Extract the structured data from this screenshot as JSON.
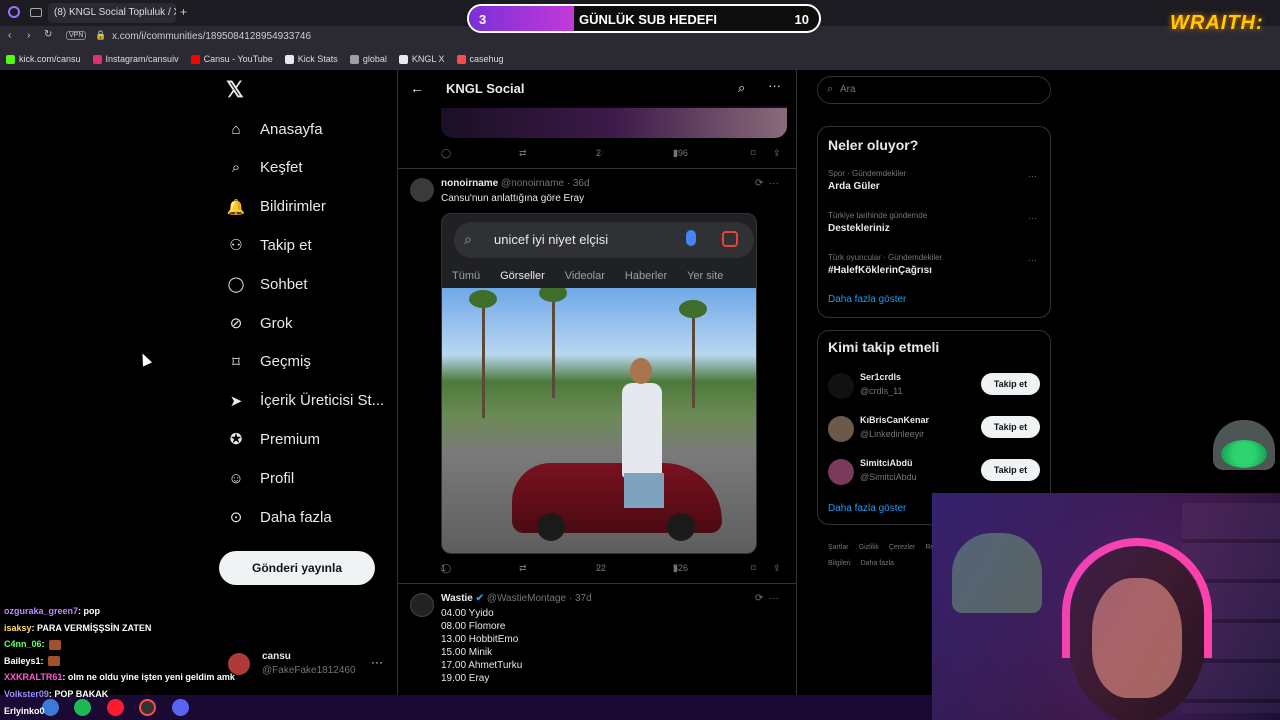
{
  "browser": {
    "tab_title": "(8) KNGL Social Topluluk / X",
    "url": "x.com/i/communities/1895084128954933746",
    "vpn": "VPN",
    "bookmarks": [
      {
        "label": "kick.com/cansu",
        "color": "#53fc18"
      },
      {
        "label": "Instagram/cansuiv",
        "color": "#e1306c"
      },
      {
        "label": "Cansu - YouTube",
        "color": "#ff0000"
      },
      {
        "label": "Kick Stats",
        "color": "#e7e9ea"
      },
      {
        "label": "global",
        "color": "#9aa0a6"
      },
      {
        "label": "KNGL X",
        "color": "#e7e9ea"
      },
      {
        "label": "casehug",
        "color": "#ff4a4a"
      }
    ]
  },
  "overlay": {
    "sub_goal": {
      "current": "3",
      "label": "GÜNLÜK SUB HEDEFI",
      "target": "10",
      "progress": 0.3
    },
    "brand": "WRAITH:"
  },
  "nav": {
    "items": [
      {
        "label": "Anasayfa",
        "icon": "home-icon"
      },
      {
        "label": "Keşfet",
        "icon": "search-icon"
      },
      {
        "label": "Bildirimler",
        "icon": "bell-icon"
      },
      {
        "label": "Takip et",
        "icon": "add-person-icon"
      },
      {
        "label": "Sohbet",
        "icon": "chat-icon"
      },
      {
        "label": "Grok",
        "icon": "grok-icon"
      },
      {
        "label": "Geçmiş",
        "icon": "bookmark-icon"
      },
      {
        "label": "İçerik Üreticisi St...",
        "icon": "rocket-icon"
      },
      {
        "label": "Premium",
        "icon": "verified-icon"
      },
      {
        "label": "Profil",
        "icon": "person-icon"
      },
      {
        "label": "Daha fazla",
        "icon": "more-circle-icon"
      }
    ],
    "post_button": "Gönderi yayınla",
    "account": {
      "name": "cansu",
      "handle": "@FakeFake1812460"
    }
  },
  "community": {
    "title": "KNGL Social",
    "prev_actions": {
      "likes": "2",
      "views": "396"
    },
    "tweets": [
      {
        "name": "nonoirname",
        "handle": "@nonoirname",
        "time": "· 36d",
        "text": "Cansu'nun anlattığına göre Eray",
        "media": {
          "query": "unicef iyi niyet elçisi",
          "tabs": [
            "Tümü",
            "Görseller",
            "Videolar",
            "Haberler",
            "Yer site"
          ]
        },
        "replies": "1",
        "likes": "22",
        "views": "526"
      },
      {
        "name": "Wastie",
        "handle": "@WastieMontage",
        "time": "· 37d",
        "lines": [
          "04.00 Yyido",
          "08.00 Flomore",
          "13.00 HobbitEmo",
          "15.00 Minik",
          "17.00 AhmetTurku",
          "19.00 Eray"
        ]
      }
    ]
  },
  "right": {
    "search_placeholder": "Ara",
    "trends_title": "Neler oluyor?",
    "trends": [
      {
        "context": "Spor · Gündemdekiler",
        "name": "Arda Güler"
      },
      {
        "context": "Türkiye tarihinde gündemde",
        "name": "Destekleriniz"
      },
      {
        "context": "Türk oyuncular · Gündemdekiler",
        "name": "#HalefKöklerinÇağrısı"
      }
    ],
    "trends_show_more": "Daha fazla göster",
    "who_title": "Kimi takip etmeli",
    "who": [
      {
        "name": "Ser1crdls",
        "handle": "@crdls_11",
        "button": "Takip et"
      },
      {
        "name": "KıBrisCanKenar",
        "handle": "@Linkedinleeyir",
        "button": "Takip et"
      },
      {
        "name": "SimitciAbdü",
        "handle": "@SimitciAbdu",
        "button": "Takip et"
      }
    ],
    "who_show_more": "Daha fazla göster",
    "footer": [
      "Şartlar",
      "Gizlilik",
      "Çerezler",
      "Reklam Bilgileri",
      "Daha fazla"
    ]
  },
  "chat": [
    {
      "user": "ozguraka_green7",
      "color": "#b98cff",
      "msg": ": pop"
    },
    {
      "user": "isaksy",
      "color": "#ffdf5a",
      "msg": ": PARA VERMİŞŞSİN ZATEN"
    },
    {
      "user": "C4nn_06",
      "color": "#6bff6b",
      "msg": ":"
    },
    {
      "user": "Baileys1",
      "color": "#ffffff",
      "msg": ":"
    },
    {
      "user": "XXKRALTR61",
      "color": "#ff5ad1",
      "msg": ": olm ne oldu yine işten yeni geldim amk"
    },
    {
      "user": "Volkster09",
      "color": "#9b8cff",
      "msg": ": POP BAKAK"
    },
    {
      "user": "Erlyinko0",
      "color": "#ffffff",
      "msg": ""
    }
  ]
}
